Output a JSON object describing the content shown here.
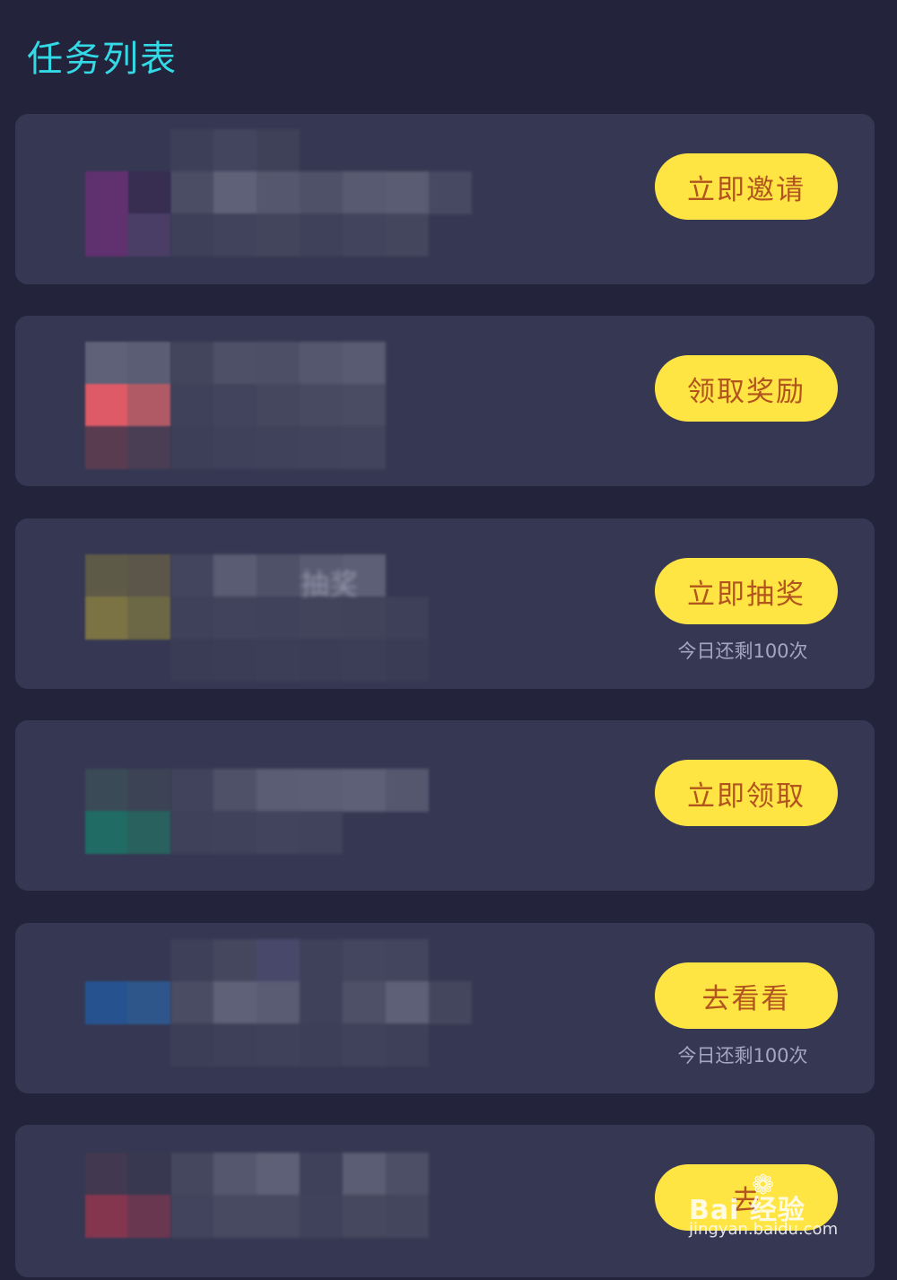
{
  "header": {
    "title": "任务列表"
  },
  "tasks": [
    {
      "title": "",
      "description": "",
      "button_label": "立即邀请",
      "remaining_text": "",
      "icon_colors": [
        "#4a3e66",
        "#61306f",
        "#5b2f6a",
        "#372e52"
      ]
    },
    {
      "title": "",
      "description": "",
      "button_label": "领取奖励",
      "remaining_text": "",
      "icon_colors": [
        "#5e6177",
        "#5a5d74",
        "#de5a66",
        "#b05a65"
      ]
    },
    {
      "title": "抽奖",
      "description": "",
      "button_label": "立即抽奖",
      "remaining_text": "今日还剩100次",
      "icon_colors": [
        "#5e5a48",
        "#5b5649",
        "#7c7344",
        "#6c6744"
      ]
    },
    {
      "title": "",
      "description": "",
      "button_label": "立即领取",
      "remaining_text": "",
      "icon_colors": [
        "#3b4a57",
        "#3c4354",
        "#206b63",
        "#28615d"
      ]
    },
    {
      "title": "",
      "description": "",
      "button_label": "去看看",
      "remaining_text": "今日还剩100次",
      "icon_colors": [
        "#3a3c55",
        "#3c3e57",
        "#26538f",
        "#2e568a"
      ]
    },
    {
      "title": "",
      "description": "",
      "button_label": "去",
      "remaining_text": "",
      "icon_colors": [
        "#42384f",
        "#383851",
        "#84364f",
        "#6a3750"
      ]
    }
  ],
  "watermark": {
    "brand": "Bai 经验",
    "url": "jingyan.baidu.com"
  },
  "colors": {
    "background": "#23243c",
    "card": "#363853",
    "title": "#34d9e6",
    "button": "#ffe543",
    "button_text": "#b2541d"
  }
}
